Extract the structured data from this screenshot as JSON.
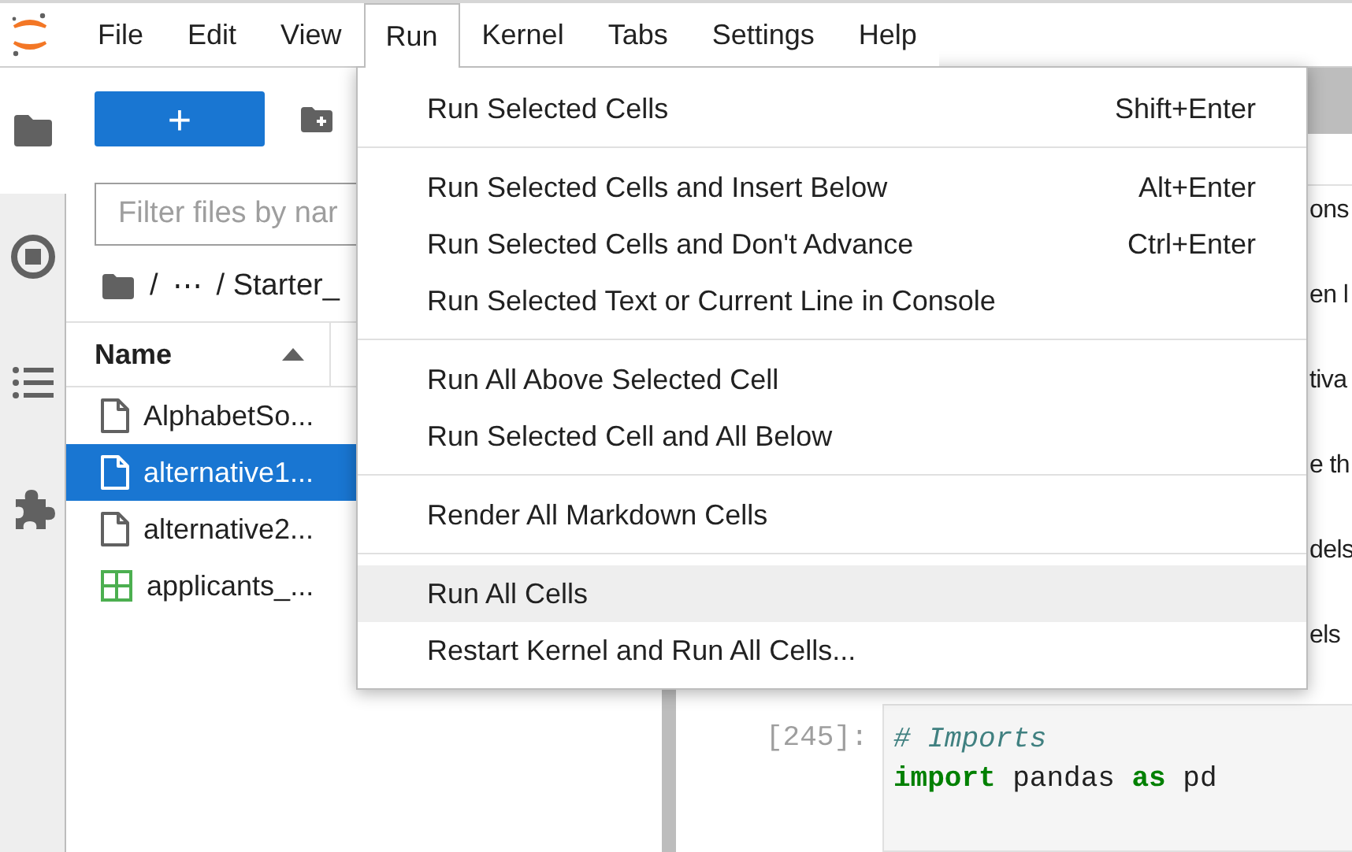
{
  "menubar": {
    "items": [
      {
        "label": "File",
        "selected": false
      },
      {
        "label": "Edit",
        "selected": false
      },
      {
        "label": "View",
        "selected": false
      },
      {
        "label": "Run",
        "selected": true
      },
      {
        "label": "Kernel",
        "selected": false
      },
      {
        "label": "Tabs",
        "selected": false
      },
      {
        "label": "Settings",
        "selected": false
      },
      {
        "label": "Help",
        "selected": false
      }
    ]
  },
  "sidebar": {
    "tabs": [
      {
        "kind": "folder",
        "selected": true
      },
      {
        "kind": "stop",
        "selected": false
      },
      {
        "kind": "list",
        "selected": false
      },
      {
        "kind": "puzzle",
        "selected": false
      }
    ]
  },
  "file_browser": {
    "new_button": "+",
    "filter": {
      "placeholder": "Filter files by nar"
    },
    "breadcrumbs": [
      "/",
      "⋯",
      "/ Starter_"
    ],
    "column": {
      "label": "Name"
    },
    "files": [
      {
        "name": "AlphabetSo...",
        "kind": "file",
        "selected": false
      },
      {
        "name": "alternative1...",
        "kind": "file",
        "selected": true
      },
      {
        "name": "alternative2...",
        "kind": "file",
        "selected": false
      },
      {
        "name": "applicants_...",
        "kind": "table",
        "selected": false
      }
    ]
  },
  "notebook": {
    "markdown_fragments": [
      "ons",
      "en l",
      "tiva",
      "e th",
      "dels",
      "els"
    ],
    "code_cell": {
      "prompt": "[245]:",
      "lines": [
        [
          {
            "text": "# Imports",
            "kind": "comment"
          }
        ],
        [
          {
            "text": "import",
            "kind": "keyword"
          },
          {
            "text": " pandas ",
            "kind": "plain"
          },
          {
            "text": "as",
            "kind": "keyword"
          },
          {
            "text": " pd",
            "kind": "plain"
          }
        ]
      ]
    }
  },
  "run_menu": {
    "groups": [
      [
        {
          "label": "Run Selected Cells",
          "shortcut": "Shift+Enter",
          "selected": false
        }
      ],
      [
        {
          "label": "Run Selected Cells and Insert Below",
          "shortcut": "Alt+Enter",
          "selected": false
        },
        {
          "label": "Run Selected Cells and Don't Advance",
          "shortcut": "Ctrl+Enter",
          "selected": false
        },
        {
          "label": "Run Selected Text or Current Line in Console",
          "selected": false
        }
      ],
      [
        {
          "label": "Run All Above Selected Cell",
          "selected": false
        },
        {
          "label": "Run Selected Cell and All Below",
          "selected": false
        }
      ],
      [
        {
          "label": "Render All Markdown Cells",
          "selected": false
        }
      ],
      [
        {
          "label": "Run All Cells",
          "selected": true
        },
        {
          "label": "Restart Kernel and Run All Cells...",
          "selected": false
        }
      ]
    ]
  }
}
